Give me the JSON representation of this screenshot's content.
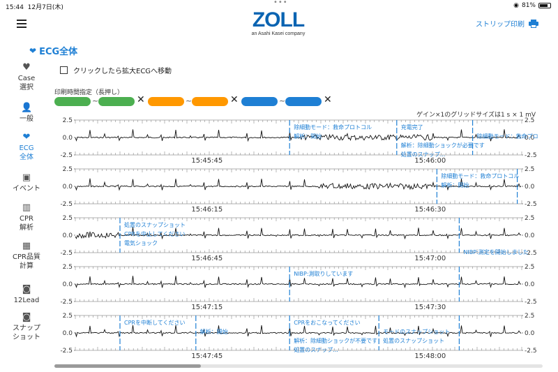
{
  "status": {
    "time": "15:44",
    "date": "12月7日(木)",
    "battery": "81%"
  },
  "header": {
    "brand": "ZOLL",
    "brand_sub": "an Asahi Kasei company",
    "strip_print_label": "ストリップ印刷"
  },
  "page_title": "ECG全体",
  "sidebar": {
    "items": [
      {
        "line1": "Case",
        "line2": "選択",
        "icon": "case-icon",
        "active": false
      },
      {
        "line1": "一般",
        "line2": "",
        "icon": "person-icon",
        "active": false
      },
      {
        "line1": "ECG",
        "line2": "全体",
        "icon": "heart-icon",
        "active": true
      },
      {
        "line1": "イベント",
        "line2": "",
        "icon": "calendar-icon",
        "active": false
      },
      {
        "line1": "CPR",
        "line2": "解析",
        "icon": "bar-chart-icon",
        "active": false
      },
      {
        "line1": "CPR品質",
        "line2": "計算",
        "icon": "calculator-icon",
        "active": false
      },
      {
        "line1": "12Lead",
        "line2": "",
        "icon": "camera-icon",
        "active": false
      },
      {
        "line1": "スナップ",
        "line2": "ショット",
        "icon": "snapshot-camera-icon",
        "active": false
      }
    ]
  },
  "checkbox_label": "クリックしたら拡大ECGへ移動",
  "print_time_label": "印刷時間指定（長押し）",
  "pill_ranges": [
    {
      "color": "#4caf50",
      "tilde": "~"
    },
    {
      "color": "#ff9800",
      "tilde": "~"
    },
    {
      "color": "#1e7fd4",
      "tilde": "~"
    }
  ],
  "pill_close": "✕",
  "grid_note": "ゲイン×1のグリッドサイズは1 s × 1 mV",
  "y_ticks": [
    "2.5",
    "0.0",
    "-2.5"
  ],
  "strips": [
    {
      "times": [
        "15:45:45",
        "15:46:00"
      ],
      "events": [
        {
          "t": 0.48,
          "labels": [
            "除細動モード：救命プロトコル",
            "解析：開始"
          ]
        },
        {
          "t": 0.72,
          "labels": [
            "充電完了",
            "",
            "解析：除細動ショックが必要です",
            "処置のスナップ..."
          ]
        },
        {
          "t": 0.89,
          "labels": [
            "",
            "除細動モード：救命プロ"
          ]
        }
      ]
    },
    {
      "times": [
        "15:46:15",
        "15:46:30"
      ],
      "events": [
        {
          "t": 0.81,
          "labels": [
            "除細動モード：救命プロトコル",
            "解析：開始"
          ]
        },
        {
          "t": 0.99,
          "labels": []
        }
      ]
    },
    {
      "times": [
        "15:46:45",
        "15:47:00"
      ],
      "events": [
        {
          "t": 0.1,
          "labels": [
            "処置のスナップショット",
            "CPRを中止してください",
            "電気ショック"
          ]
        },
        {
          "t": 0.86,
          "labels": [
            "",
            "",
            "",
            "NIBP:測定を開始しました"
          ]
        }
      ]
    },
    {
      "times": [
        "15:47:15",
        "15:47:30"
      ],
      "events": [
        {
          "t": 0.48,
          "labels": [
            "NIBP:測取りしています"
          ]
        },
        {
          "t": 0.86,
          "labels": []
        }
      ]
    },
    {
      "times": [
        "15:47:45",
        "15:48:00"
      ],
      "events": [
        {
          "t": 0.1,
          "labels": [
            "CPRを中断してください"
          ]
        },
        {
          "t": 0.27,
          "labels": [
            "",
            "解析：開始"
          ]
        },
        {
          "t": 0.48,
          "labels": [
            "CPRをおこなってください",
            "",
            "解析：除細動ショックが不要です",
            "処置のスナップ..."
          ]
        },
        {
          "t": 0.68,
          "labels": [
            "",
            "モードのスナップショット",
            "処置のスナップショット"
          ]
        },
        {
          "t": 0.86,
          "labels": []
        }
      ]
    }
  ]
}
